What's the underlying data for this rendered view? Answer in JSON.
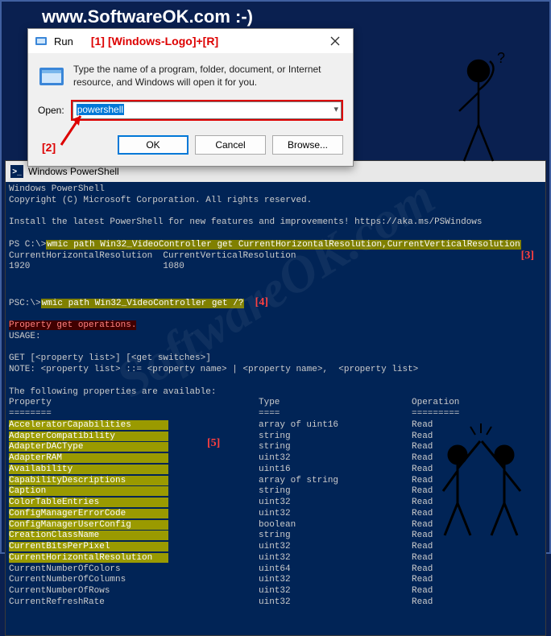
{
  "header": {
    "site": "www.SoftwareOK.com :-)"
  },
  "annotations": {
    "a1": "[1]",
    "hotkey": "[Windows-Logo]+[R]",
    "a2": "[2]",
    "a3": "[3]",
    "a4": "[4]",
    "a5": "[5]"
  },
  "run_dialog": {
    "title": "Run",
    "description": "Type the name of a program, folder, document, or Internet resource, and Windows will open it for you.",
    "open_label": "Open:",
    "input_value": "powershell",
    "buttons": {
      "ok": "OK",
      "cancel": "Cancel",
      "browse": "Browse..."
    }
  },
  "ps": {
    "title": "Windows PowerShell",
    "banner1": "Windows PowerShell",
    "banner2": "Copyright (C) Microsoft Corporation. All rights reserved.",
    "install": "Install the latest PowerShell for new features and improvements! https://aka.ms/PSWindows",
    "prompt": "PS C:\\>",
    "prompt2": "PSC:\\>",
    "cmd1": "wmic path Win32_VideoController get CurrentHorizontalResolution,CurrentVerticalResolution",
    "hdr1": "CurrentHorizontalResolution  CurrentVerticalResolution",
    "val1": "1920                         1080",
    "cmd2": "wmic path Win32_VideoController get /?",
    "err": "Property get operations.",
    "usage": "USAGE:",
    "get1": "GET [<property list>] [<get switches>]",
    "get2": "NOTE: <property list> ::= <property name> | <property name>,  <property list>",
    "avail": "The following properties are available:",
    "th": {
      "p": "Property",
      "t": "Type",
      "o": "Operation"
    },
    "sep": {
      "p": "========",
      "t": "====",
      "o": "========="
    },
    "rows": [
      {
        "p": "AcceleratorCapabilities",
        "t": "array of uint16",
        "o": "Read"
      },
      {
        "p": "AdapterCompatibility",
        "t": "string",
        "o": "Read"
      },
      {
        "p": "AdapterDACType",
        "t": "string",
        "o": "Read"
      },
      {
        "p": "AdapterRAM",
        "t": "uint32",
        "o": "Read"
      },
      {
        "p": "Availability",
        "t": "uint16",
        "o": "Read"
      },
      {
        "p": "CapabilityDescriptions",
        "t": "array of string",
        "o": "Read"
      },
      {
        "p": "Caption",
        "t": "string",
        "o": "Read"
      },
      {
        "p": "ColorTableEntries",
        "t": "uint32",
        "o": "Read"
      },
      {
        "p": "ConfigManagerErrorCode",
        "t": "uint32",
        "o": "Read"
      },
      {
        "p": "ConfigManagerUserConfig",
        "t": "boolean",
        "o": "Read"
      },
      {
        "p": "CreationClassName",
        "t": "string",
        "o": "Read"
      },
      {
        "p": "CurrentBitsPerPixel",
        "t": "uint32",
        "o": "Read"
      },
      {
        "p": "CurrentHorizontalResolution",
        "t": "uint32",
        "o": "Read"
      },
      {
        "p": "CurrentNumberOfColors",
        "t": "uint64",
        "o": "Read"
      },
      {
        "p": "CurrentNumberOfColumns",
        "t": "uint32",
        "o": "Read"
      },
      {
        "p": "CurrentNumberOfRows",
        "t": "uint32",
        "o": "Read"
      },
      {
        "p": "CurrentRefreshRate",
        "t": "uint32",
        "o": "Read"
      }
    ]
  },
  "watermark": "SoftwareOK.com"
}
